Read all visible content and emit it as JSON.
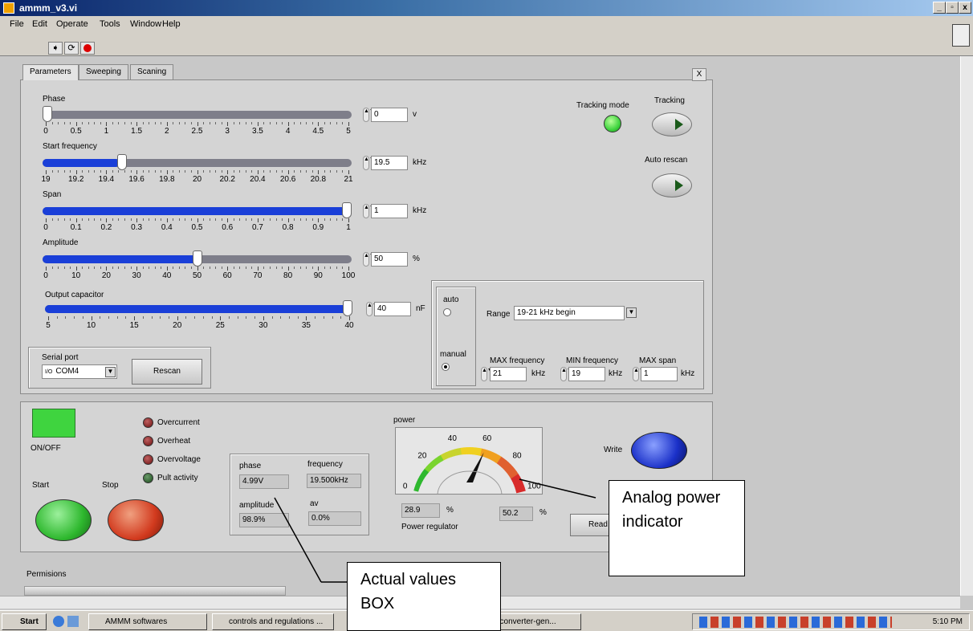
{
  "window": {
    "title": "ammm_v3.vi"
  },
  "menu": [
    "File",
    "Edit",
    "Operate",
    "Tools",
    "Window",
    "Help"
  ],
  "tabs": [
    "Parameters",
    "Sweeping",
    "Scaning"
  ],
  "tab_close": "X",
  "sliders": {
    "phase": {
      "label": "Phase",
      "value": "0",
      "unit": "v",
      "fraction": 0.0,
      "ticks": [
        "0",
        "0.5",
        "1",
        "1.5",
        "2",
        "2.5",
        "3",
        "3.5",
        "4",
        "4.5",
        "5"
      ]
    },
    "start_frequency": {
      "label": "Start frequency",
      "value": "19.5",
      "unit": "kHz",
      "fraction": 0.25,
      "ticks": [
        "19",
        "19.2",
        "19.4",
        "19.6",
        "19.8",
        "20",
        "20.2",
        "20.4",
        "20.6",
        "20.8",
        "21"
      ]
    },
    "span": {
      "label": "Span",
      "value": "1",
      "unit": "kHz",
      "fraction": 1.0,
      "ticks": [
        "0",
        "0.1",
        "0.2",
        "0.3",
        "0.4",
        "0.5",
        "0.6",
        "0.7",
        "0.8",
        "0.9",
        "1"
      ]
    },
    "amplitude": {
      "label": "Amplitude",
      "value": "50",
      "unit": "%",
      "fraction": 0.5,
      "ticks": [
        "0",
        "10",
        "20",
        "30",
        "40",
        "50",
        "60",
        "70",
        "80",
        "90",
        "100"
      ]
    },
    "output_capacitor": {
      "label": "Output capacitor",
      "value": "40",
      "unit": "nF",
      "fraction": 1.0,
      "ticks": [
        "5",
        "10",
        "15",
        "20",
        "25",
        "30",
        "35",
        "40"
      ]
    }
  },
  "tracking": {
    "mode_label": "Tracking mode",
    "button_label": "Tracking",
    "rescan_label": "Auto rescan"
  },
  "range_group": {
    "auto_label": "auto",
    "manual_label": "manual",
    "range_label": "Range",
    "range_value": "19-21 kHz begin",
    "max_freq_label": "MAX frequency",
    "max_freq_value": "21",
    "max_freq_unit": "kHz",
    "min_freq_label": "MIN frequency",
    "min_freq_value": "19",
    "min_freq_unit": "kHz",
    "max_span_label": "MAX span",
    "max_span_value": "1",
    "max_span_unit": "kHz"
  },
  "serial": {
    "label": "Serial port",
    "port_prefix": "I/O",
    "port": "COM4",
    "rescan": "Rescan"
  },
  "controls": {
    "onoff": "ON/OFF",
    "start": "Start",
    "stop": "Stop",
    "write": "Write",
    "read": "Read"
  },
  "status_leds": [
    "Overcurrent",
    "Overheat",
    "Overvoltage",
    "Pult activity"
  ],
  "actual_values": {
    "phase_label": "phase",
    "phase_value": "4.99V",
    "frequency_label": "frequency",
    "frequency_value": "19.500kHz",
    "amplitude_label": "amplitude",
    "amplitude_value": "98.9%",
    "av_label": "av",
    "av_value": "0.0%"
  },
  "power": {
    "label": "power",
    "gauge_ticks": [
      "0",
      "20",
      "40",
      "60",
      "80",
      "100"
    ],
    "needle_value": 60,
    "regulator_value": "28.9",
    "regulator_unit": "%",
    "regulator_label": "Power regulator",
    "second_value": "50.2",
    "second_unit": "%"
  },
  "permissions": "Permisions",
  "callouts": {
    "analog": "Analog power indicator",
    "actual": "Actual values BOX"
  },
  "taskbar": {
    "start": "Start",
    "items": [
      "AMMM softwares",
      "controls and regulations ...",
      "nic converter-gen..."
    ],
    "time": "5:10 PM"
  },
  "colors": {
    "fill_blue": "#1a3fd8",
    "led_green": "#3fd43f",
    "btn_green": "#2eb82e",
    "btn_red": "#d23a1e",
    "btn_blue": "#1a30c8"
  }
}
